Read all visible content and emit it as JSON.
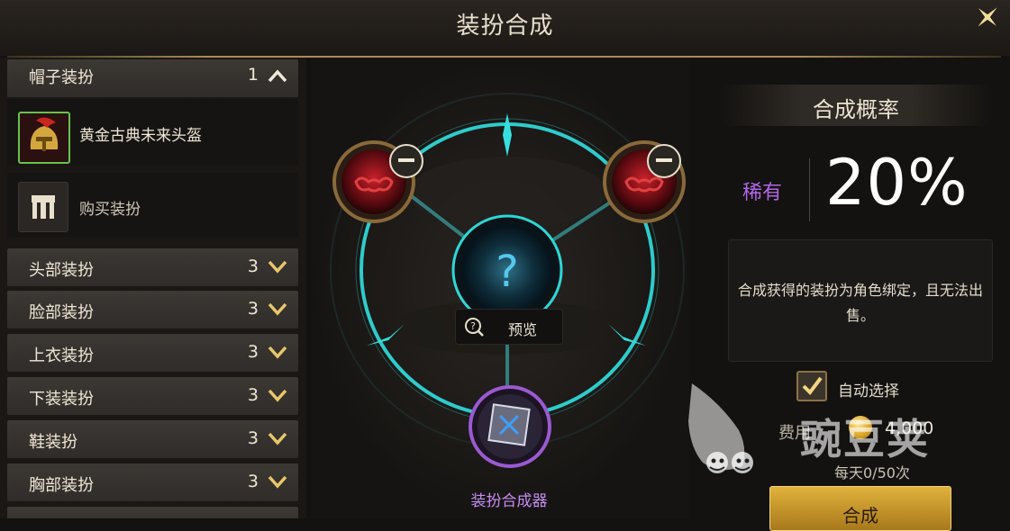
{
  "header": {
    "title": "装扮合成"
  },
  "sidebar": {
    "expanded_category": {
      "label": "帽子装扮",
      "count": "1"
    },
    "selected_item": {
      "name": "黄金古典未来头盔"
    },
    "buy_item": {
      "label": "购买装扮"
    },
    "categories": [
      {
        "label": "头部装扮",
        "count": "3"
      },
      {
        "label": "脸部装扮",
        "count": "3"
      },
      {
        "label": "上衣装扮",
        "count": "3"
      },
      {
        "label": "下装装扮",
        "count": "3"
      },
      {
        "label": "鞋装扮",
        "count": "3"
      },
      {
        "label": "胸部装扮",
        "count": "3"
      }
    ]
  },
  "stage": {
    "preview_label": "预览",
    "synthesizer_name": "装扮合成器"
  },
  "panel": {
    "title": "合成概率",
    "rarity": "稀有",
    "probability": "20%",
    "description": "合成获得的装扮为角色绑定，且无法出售。",
    "auto_select_label": "自动选择",
    "auto_select_checked": true,
    "fee_label": "费用",
    "fee_value": "4,000",
    "daily_limit": "每天0/50次",
    "synth_button_label": "合成"
  },
  "watermark": {
    "text": "豌豆荚"
  },
  "colors": {
    "accent_gold": "#a88c52",
    "ring_cyan": "#2fd6d6",
    "rarity_purple": "#b266e8"
  }
}
